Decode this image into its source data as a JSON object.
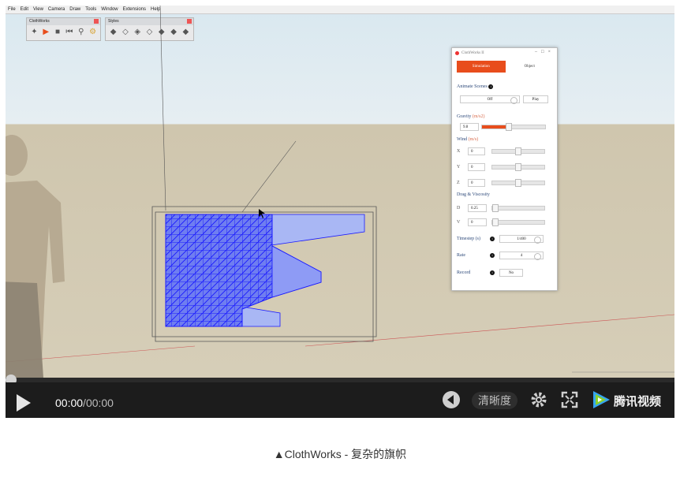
{
  "menubar": {
    "items": [
      "File",
      "Edit",
      "View",
      "Camera",
      "Draw",
      "Tools",
      "Window",
      "Extensions",
      "Help"
    ]
  },
  "toolbars": {
    "clothworks_title": "ClothWorks",
    "styles_title": "Styles"
  },
  "panel": {
    "title": "ClothWorks II",
    "tabs": [
      "Simulation",
      "Object"
    ],
    "animate_scenes": {
      "label": "Animate Scenes",
      "value": "Off",
      "button": "Play"
    },
    "gravity": {
      "label": "Gravity",
      "unit": "(m/s2)",
      "value": "9.8",
      "fraction": 0.42
    },
    "wind": {
      "label": "Wind",
      "unit": "(m/s)",
      "axes": [
        {
          "axis": "X",
          "value": "0",
          "fraction": 0.5
        },
        {
          "axis": "Y",
          "value": "0",
          "fraction": 0.5
        },
        {
          "axis": "Z",
          "value": "0",
          "fraction": 0.5
        }
      ]
    },
    "drag_viscosity": {
      "label": "Drag & Viscosity",
      "rows": [
        {
          "axis": "D",
          "value": "0.25",
          "fraction": 0.05
        },
        {
          "axis": "V",
          "value": "0",
          "fraction": 0.0
        }
      ]
    },
    "timestep": {
      "label": "Timestep (s)",
      "value": "1/400"
    },
    "rate": {
      "label": "Rate",
      "value": "4"
    },
    "record": {
      "label": "Record",
      "value": "No"
    }
  },
  "player": {
    "current_time": "00:00",
    "separator": "/",
    "duration": "00:00",
    "quality_label": "清晰度",
    "brand": "腾讯视频"
  },
  "caption": "▲ClothWorks - 复杂的旗帜",
  "colors": {
    "accent": "#e84d1c",
    "mesh": "#1a1aff"
  }
}
